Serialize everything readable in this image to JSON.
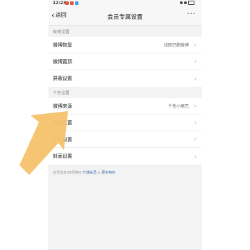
{
  "status_bar": {
    "time": "12:23",
    "icon_colors": [
      "#e5533b",
      "#e5533b",
      "#3aa0e8"
    ]
  },
  "nav": {
    "back_label": "返回",
    "title": "会员专属设置",
    "more_label": "···"
  },
  "sections": [
    {
      "header": "微博设置",
      "rows": [
        {
          "label": "微博恢复",
          "value": "找回已删微博"
        },
        {
          "label": "微博置顶",
          "value": ""
        },
        {
          "label": "屏蔽设置",
          "value": ""
        }
      ]
    },
    {
      "header": "个性设置",
      "rows": [
        {
          "label": "微博来源",
          "value": "个性小尾巴"
        },
        {
          "label": "挂件设置",
          "value": ""
        },
        {
          "label": "卡片设置",
          "value": ""
        },
        {
          "label": "封面设置",
          "value": ""
        }
      ]
    }
  ],
  "footer": {
    "text": "会员尊享38项特权",
    "link_open": "开通会员",
    "separator": "&",
    "link_more": "更多特权"
  },
  "overlay": {
    "arrow_color": "#f5c26b",
    "arrow_icon": "arrow-pointer-icon"
  }
}
